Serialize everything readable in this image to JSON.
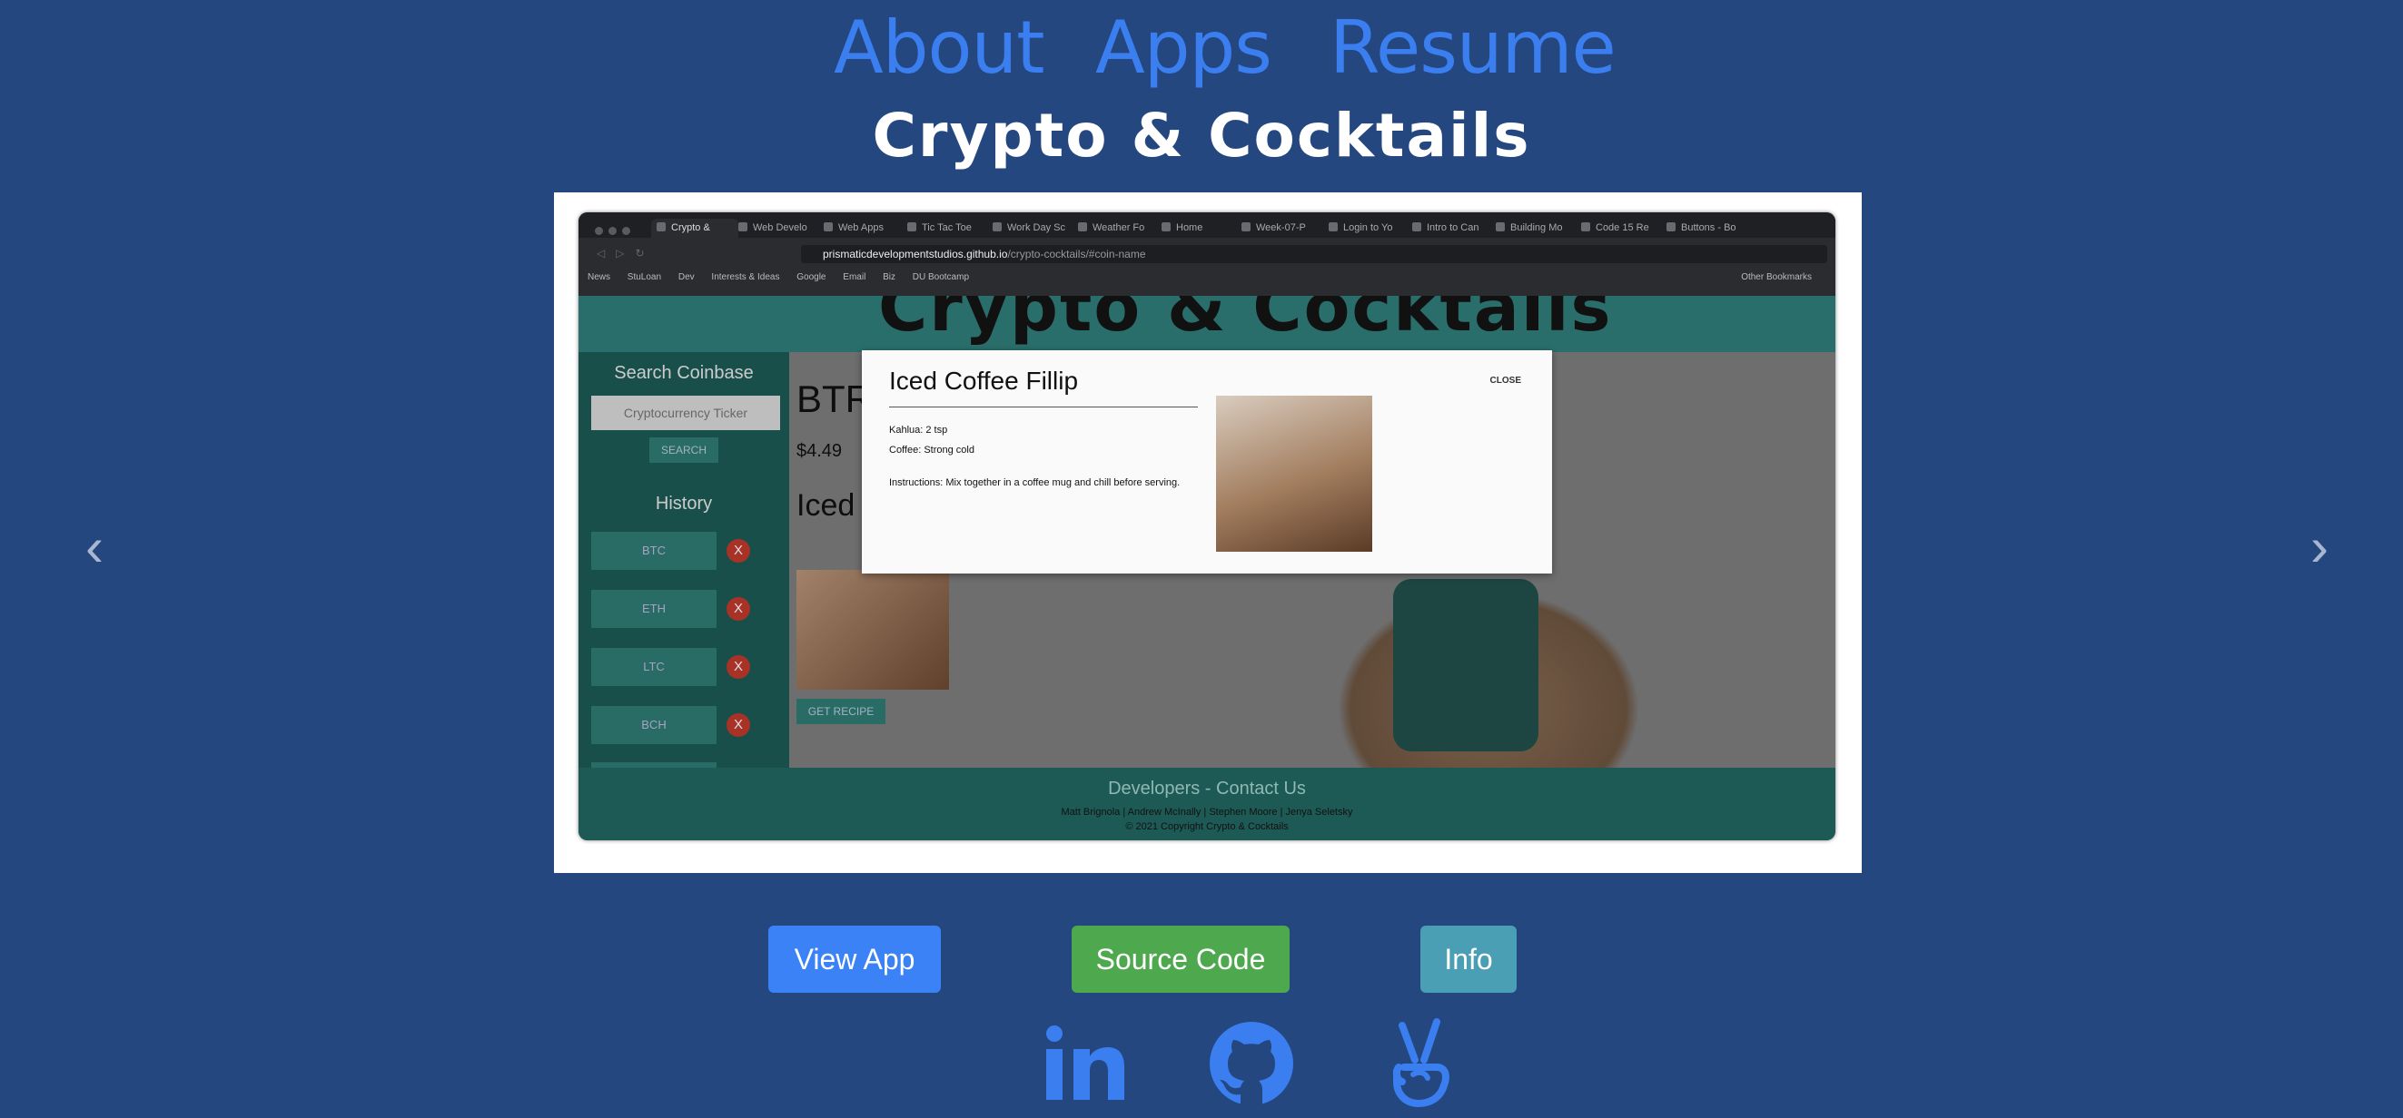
{
  "nav": {
    "about": "About",
    "apps": "Apps",
    "resume": "Resume"
  },
  "project_title": "Crypto & Cocktails",
  "browser": {
    "tabs": [
      "Crypto &",
      "Web Develo",
      "Web Apps",
      "Tic Tac Toe",
      "Work Day Sc",
      "Weather Fo",
      "Home",
      "Week-07-P",
      "Login to Yo",
      "Intro to Can",
      "Building Mo",
      "Code 15 Re",
      "Buttons - Bo"
    ],
    "url_host": "prismaticdevelopmentstudios.github.io",
    "url_path": "/crypto-cocktails/#coin-name",
    "bookmarks": [
      "News",
      "StuLoan",
      "Dev",
      "Interests & Ideas",
      "Google",
      "Email",
      "Biz",
      "DU Bootcamp"
    ],
    "other_bookmarks": "Other Bookmarks"
  },
  "app": {
    "header_logo": "Crypto & Cocktails",
    "search_label": "Search Coinbase",
    "search_placeholder": "Cryptocurrency Ticker",
    "search_button": "SEARCH",
    "history_label": "History",
    "history": [
      "BTC",
      "ETH",
      "LTC",
      "BCH"
    ],
    "remove_label": "X",
    "ticker": "BTR",
    "price": "$4.49",
    "drink_heading": "Iced",
    "get_recipe": "GET RECIPE",
    "footer_heading": "Developers - Contact Us",
    "footer_names": "Matt Brignola | Andrew McInally | Stephen Moore | Jenya Seletsky",
    "footer_copyright": "© 2021 Copyright    Crypto & Cocktails"
  },
  "modal": {
    "title": "Iced Coffee Fillip",
    "close": "CLOSE",
    "ingredient1": "Kahlua: 2 tsp",
    "ingredient2": "Coffee: Strong cold",
    "instructions": "Instructions: Mix together in a coffee mug and chill before serving."
  },
  "carousel": {
    "prev": "‹",
    "next": "›"
  },
  "buttons": {
    "view_app": "View App",
    "source_code": "Source Code",
    "info": "Info"
  },
  "colors": {
    "background": "#24477f",
    "nav_link": "#3a7ef0",
    "view_app": "#3b82f6",
    "source_code": "#4ea84e",
    "info": "#4a9fb5"
  }
}
